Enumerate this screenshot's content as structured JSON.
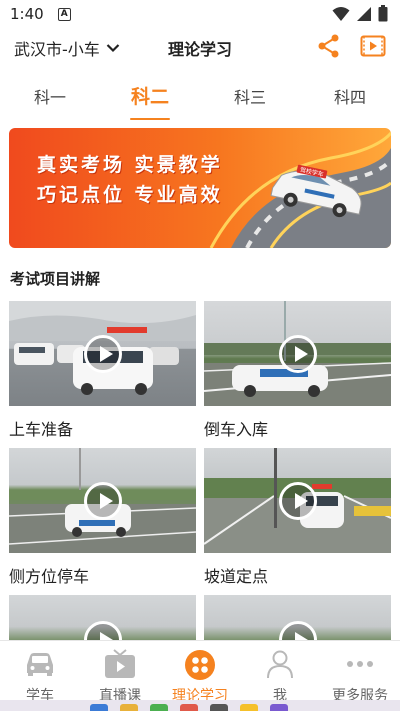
{
  "status_bar": {
    "time": "1:40",
    "notification_letter": "A"
  },
  "header": {
    "city": "武汉市-小车",
    "title": "理论学习"
  },
  "tabs": [
    {
      "label": "科一",
      "active": false
    },
    {
      "label": "科二",
      "active": true
    },
    {
      "label": "科三",
      "active": false
    },
    {
      "label": "科四",
      "active": false
    }
  ],
  "banner": {
    "line1": "真实考场 实景教学",
    "line2": "巧记点位 专业高效",
    "car_text": "驾校学车"
  },
  "section": {
    "title": "考试项目讲解"
  },
  "videos": [
    {
      "label": "上车准备"
    },
    {
      "label": "倒车入库"
    },
    {
      "label": "侧方位停车"
    },
    {
      "label": "坡道定点"
    },
    {
      "label": ""
    },
    {
      "label": ""
    }
  ],
  "bottom_nav": [
    {
      "label": "学车",
      "icon": "car-icon",
      "active": false
    },
    {
      "label": "直播课",
      "icon": "tv-icon",
      "active": false
    },
    {
      "label": "理论学习",
      "icon": "grid-dots-icon",
      "active": true
    },
    {
      "label": "我",
      "icon": "person-icon",
      "active": false
    },
    {
      "label": "更多服务",
      "icon": "more-icon",
      "active": false
    }
  ],
  "colors": {
    "accent": "#f5821f",
    "banner_start": "#f04a1e",
    "banner_end": "#ffa83a"
  }
}
